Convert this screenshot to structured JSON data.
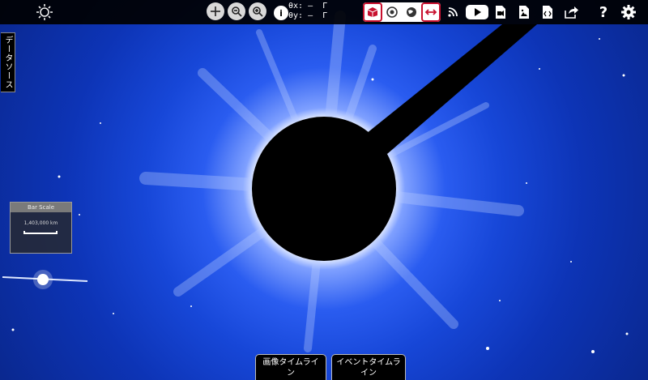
{
  "toolbar": {
    "coords": {
      "x_label": "θx",
      "x_value": ": —  Γ",
      "y_label": "θy",
      "y_value": ": —  Γ"
    },
    "icons": [
      "sun-logo-icon",
      "pan-icon",
      "zoom-out-icon",
      "zoom-in-icon",
      "info-icon",
      "cube-icon",
      "disc-icon",
      "globe-icon",
      "measure-arrows-icon",
      "rss-icon",
      "youtube-icon",
      "movie-icon",
      "image-icon",
      "code-icon",
      "share-icon",
      "help-icon",
      "settings-icon"
    ],
    "help_label": "?"
  },
  "sidebar": {
    "data_sources_label": "データソース"
  },
  "bar_scale": {
    "title": "Bar Scale",
    "value": "1,403,000 km"
  },
  "bottom_tabs": {
    "image_timeline": "画像タイムライン",
    "event_timeline": "イベントタイムライン"
  },
  "colors": {
    "sky_blue": "#1747d8",
    "toolbar_bg": "#000000",
    "accent_red": "#c8102e"
  }
}
